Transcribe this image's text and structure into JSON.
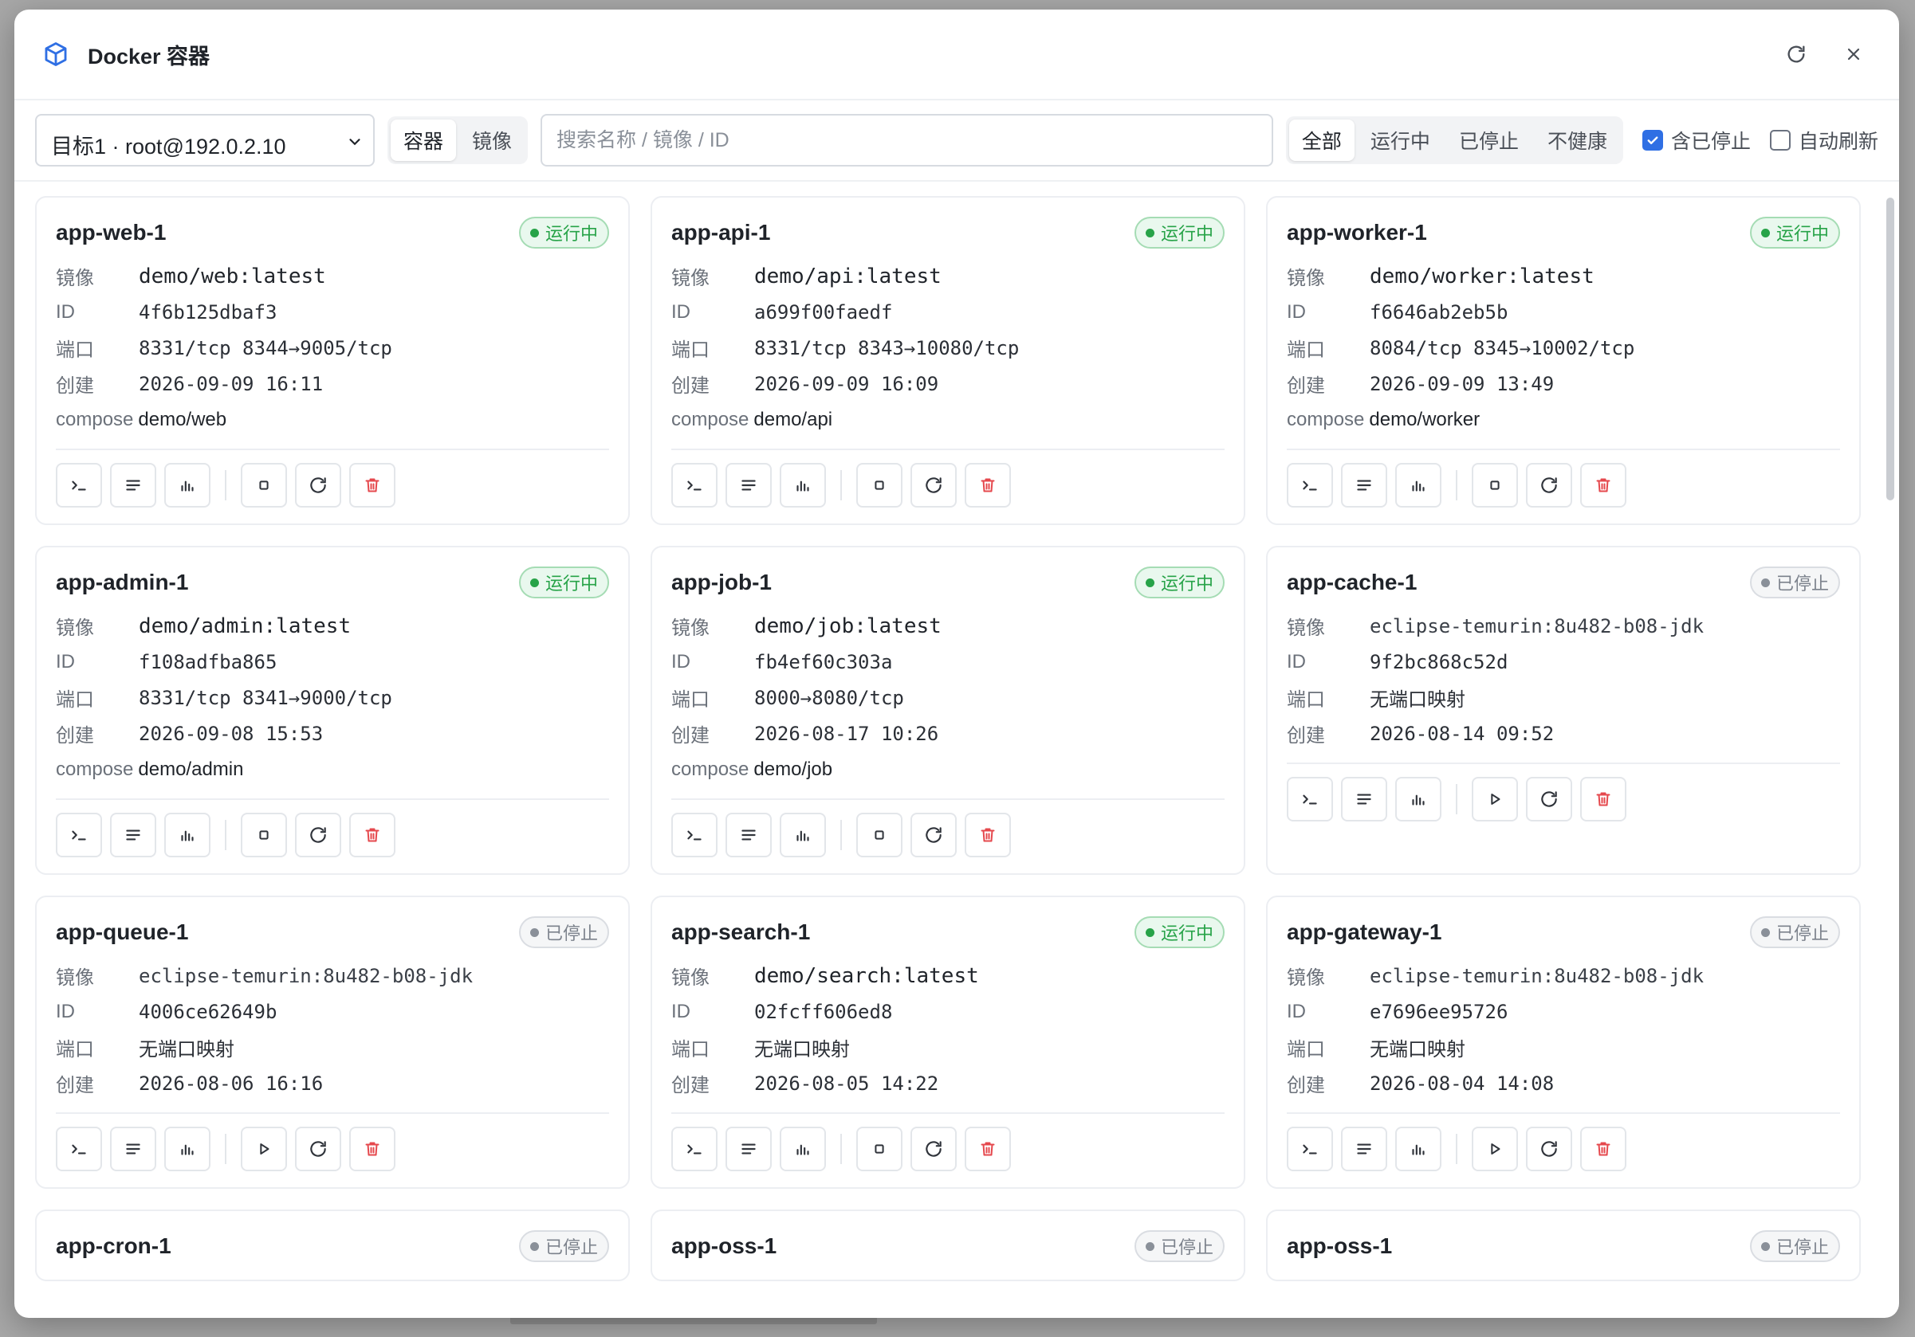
{
  "window": {
    "title": "Docker 容器"
  },
  "toolbar": {
    "target": "目标1 · root@192.0.2.10",
    "tabs": [
      {
        "label": "容器",
        "active": true
      },
      {
        "label": "镜像",
        "active": false
      }
    ],
    "search_placeholder": "搜索名称 / 镜像 / ID",
    "filters": [
      {
        "label": "全部",
        "active": true
      },
      {
        "label": "运行中",
        "active": false
      },
      {
        "label": "已停止",
        "active": false
      },
      {
        "label": "不健康",
        "active": false
      }
    ],
    "include_stopped": {
      "label": "含已停止",
      "checked": true
    },
    "auto_refresh": {
      "label": "自动刷新",
      "checked": false
    }
  },
  "labels": {
    "image": "镜像",
    "id": "ID",
    "ports": "端口",
    "created": "创建",
    "compose": "compose"
  },
  "containers": [
    {
      "name": "app-web-1",
      "status": "运行中",
      "running": true,
      "image": "demo/web:latest",
      "id": "4f6b125dbaf3",
      "ports": "8331/tcp 8344→9005/tcp",
      "created": "2026-09-09 16:11",
      "compose": "demo/web"
    },
    {
      "name": "app-api-1",
      "status": "运行中",
      "running": true,
      "image": "demo/api:latest",
      "id": "a699f00faedf",
      "ports": "8331/tcp 8343→10080/tcp",
      "created": "2026-09-09 16:09",
      "compose": "demo/api"
    },
    {
      "name": "app-worker-1",
      "status": "运行中",
      "running": true,
      "image": "demo/worker:latest",
      "id": "f6646ab2eb5b",
      "ports": "8084/tcp 8345→10002/tcp",
      "created": "2026-09-09 13:49",
      "compose": "demo/worker"
    },
    {
      "name": "app-admin-1",
      "status": "运行中",
      "running": true,
      "image": "demo/admin:latest",
      "id": "f108adfba865",
      "ports": "8331/tcp 8341→9000/tcp",
      "created": "2026-09-08 15:53",
      "compose": "demo/admin"
    },
    {
      "name": "app-job-1",
      "status": "运行中",
      "running": true,
      "image": "demo/job:latest",
      "id": "fb4ef60c303a",
      "ports": "8000→8080/tcp",
      "created": "2026-08-17 10:26",
      "compose": "demo/job"
    },
    {
      "name": "app-cache-1",
      "status": "已停止",
      "running": false,
      "image": "eclipse-temurin:8u482-b08-jdk",
      "id": "9f2bc868c52d",
      "ports": "无端口映射",
      "created": "2026-08-14 09:52",
      "compose": null
    },
    {
      "name": "app-queue-1",
      "status": "已停止",
      "running": false,
      "image": "eclipse-temurin:8u482-b08-jdk",
      "id": "4006ce62649b",
      "ports": "无端口映射",
      "created": "2026-08-06 16:16",
      "compose": null
    },
    {
      "name": "app-search-1",
      "status": "运行中",
      "running": true,
      "image": "demo/search:latest",
      "id": "02fcff606ed8",
      "ports": "无端口映射",
      "created": "2026-08-05 14:22",
      "compose": null
    },
    {
      "name": "app-gateway-1",
      "status": "已停止",
      "running": false,
      "image": "eclipse-temurin:8u482-b08-jdk",
      "id": "e7696ee95726",
      "ports": "无端口映射",
      "created": "2026-08-04 14:08",
      "compose": null
    },
    {
      "name": "app-cron-1",
      "status": "已停止",
      "running": false
    },
    {
      "name": "app-oss-1",
      "status": "已停止",
      "running": false
    },
    {
      "name": "app-oss-1",
      "status": "已停止",
      "running": false
    }
  ],
  "colors": {
    "accent": "#2f6fe4",
    "running": "#27a348",
    "danger": "#e5484d"
  }
}
